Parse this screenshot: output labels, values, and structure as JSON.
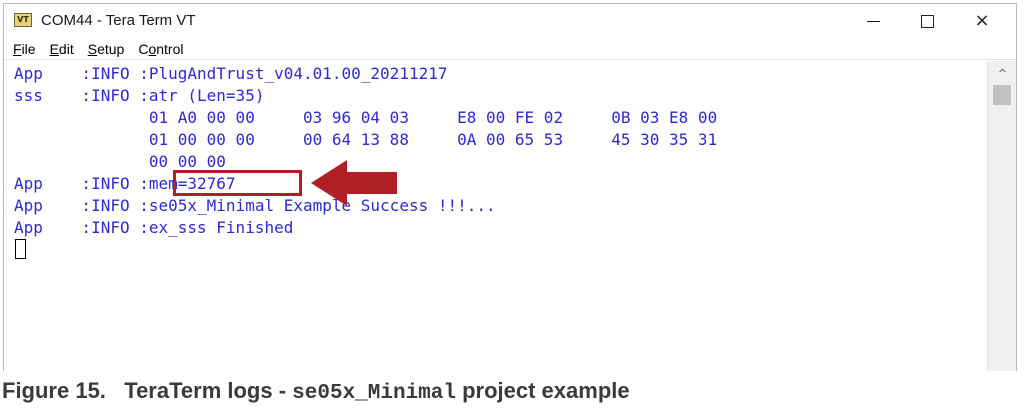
{
  "window": {
    "title": "COM44 - Tera Term VT",
    "icon_label": "VT",
    "icon": "teraterm-app-icon",
    "controls": {
      "minimize": "minimize-icon",
      "maximize": "maximize-icon",
      "close": "×"
    }
  },
  "menu": [
    {
      "underline": "F",
      "rest": "ile"
    },
    {
      "underline": "E",
      "rest": "dit"
    },
    {
      "underline": "S",
      "rest": "etup"
    },
    {
      "pre": "C",
      "underline": "o",
      "rest": "ntrol"
    }
  ],
  "terminal": {
    "text_color": "#2e2ad6",
    "lines": [
      "App    :INFO :PlugAndTrust_v04.01.00_20211217",
      "sss    :INFO :atr (Len=35)",
      "              01 A0 00 00     03 96 04 03     E8 00 FE 02     0B 03 E8 00",
      "              01 00 00 00     00 64 13 88     0A 00 65 53     45 30 35 31",
      "              00 00 00",
      "App    :INFO :mem=32767",
      "App    :INFO :se05x_Minimal Example Success !!!...",
      "App    :INFO :ex_sss Finished"
    ],
    "highlight_color": "#b01f25",
    "annotation": "red-arrow-pointing-to-mem-value"
  },
  "scrollbar": {
    "up_arrow": "^"
  },
  "caption": {
    "prefix": "Figure 15.   TeraTerm logs - ",
    "code": "se05x_Minimal",
    "suffix": " project example"
  }
}
